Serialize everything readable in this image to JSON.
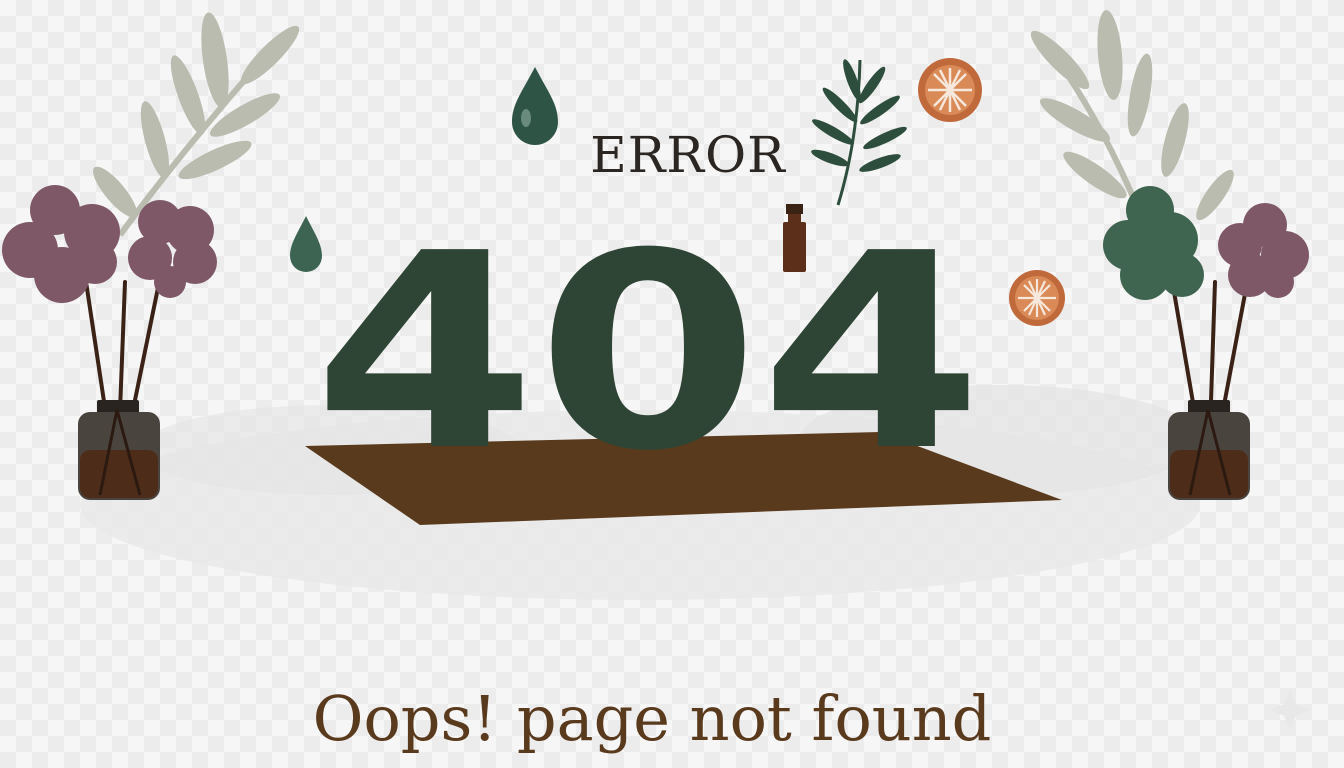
{
  "page": {
    "eyebrow": "ERROR",
    "code": "404",
    "message": "Oops! page not found"
  },
  "colors": {
    "dark_green": "#2e4434",
    "brown_shelf": "#5a3a1d",
    "mauve_flower": "#7e5867",
    "sage_leaf": "#b9bcae",
    "terracotta": "#c06a3c",
    "text_dark": "#2b2622"
  },
  "icons": [
    "olive-branch-icon",
    "mauve-flower-icon",
    "reed-diffuser-icon",
    "water-drop-icon",
    "fern-leaf-icon",
    "citrus-slice-icon",
    "oil-bottle-icon",
    "green-flower-icon",
    "sparkle-icon"
  ]
}
